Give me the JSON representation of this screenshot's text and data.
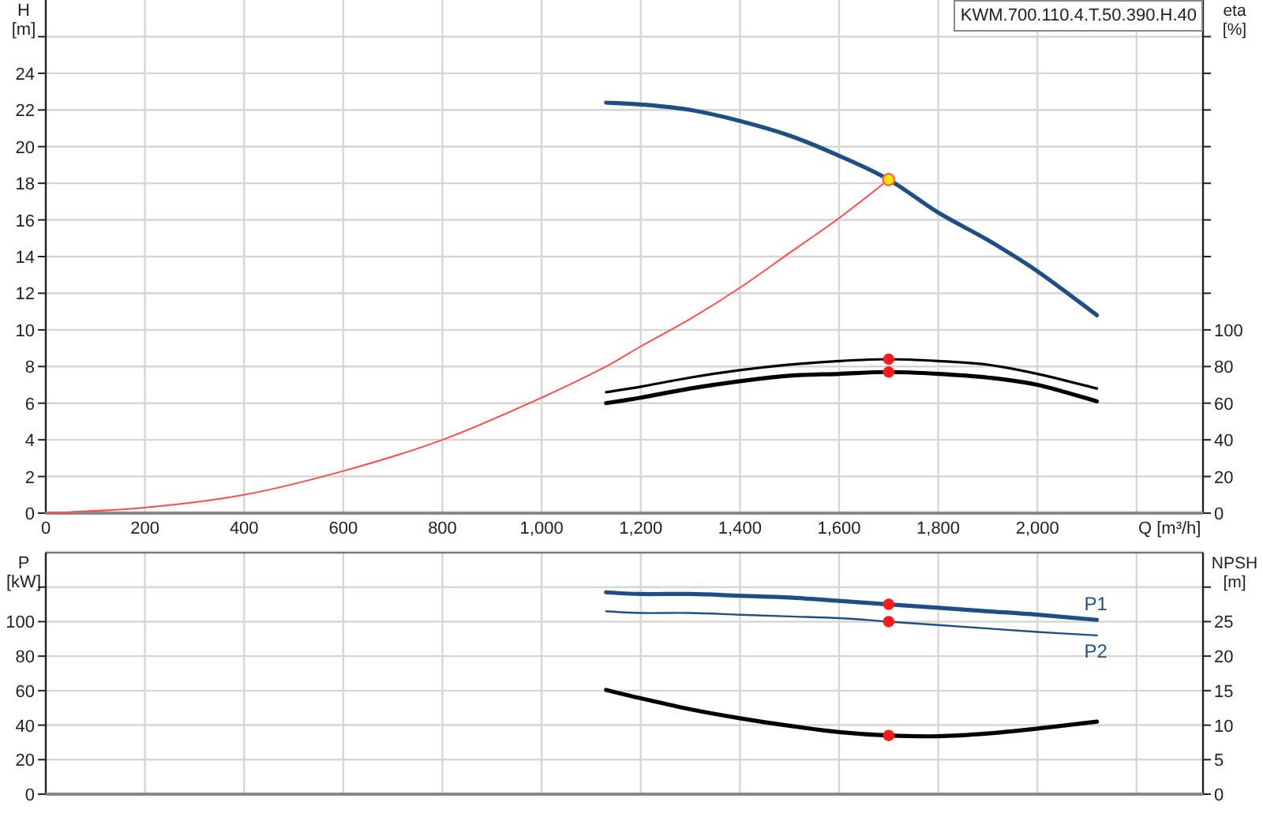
{
  "head_chart": {
    "legend": "KWM.700.110.4.T.50.390.H.40",
    "chart_data": {
      "type": "line",
      "xlabel": "Q [m³/h]",
      "ylabel": "H [m]",
      "y2label": "eta [%]",
      "grid": true,
      "x": [
        0,
        200,
        400,
        600,
        800,
        1000,
        1130,
        1200,
        1300,
        1400,
        1500,
        1600,
        1700,
        1800,
        1900,
        2000,
        2120
      ],
      "xlim": [
        0,
        2334
      ],
      "ylim": [
        0,
        28
      ],
      "y2lim": [
        0,
        280
      ],
      "xticks": [
        {
          "value": 0,
          "label": "0"
        },
        {
          "value": 200,
          "label": "200"
        },
        {
          "value": 400,
          "label": "400"
        },
        {
          "value": 600,
          "label": "600"
        },
        {
          "value": 800,
          "label": "800"
        },
        {
          "value": 1000,
          "label": "1,000"
        },
        {
          "value": 1200,
          "label": "1,200"
        },
        {
          "value": 1400,
          "label": "1,400"
        },
        {
          "value": 1600,
          "label": "1,600"
        },
        {
          "value": 1800,
          "label": "1,800"
        },
        {
          "value": 2000,
          "label": "2,000"
        }
      ],
      "yticks": [
        0,
        2,
        4,
        6,
        8,
        10,
        12,
        14,
        16,
        18,
        20,
        22,
        24
      ],
      "y2ticks": [
        0,
        20,
        40,
        60,
        80,
        100
      ],
      "series": [
        {
          "color": "#1d4f86",
          "values": [
            null,
            null,
            null,
            null,
            null,
            null,
            22.4,
            22.3,
            22.0,
            21.4,
            20.6,
            19.5,
            18.2,
            16.4,
            14.9,
            13.2,
            10.8
          ]
        },
        {
          "color": "#ff4d4d",
          "values": [
            0,
            0.3,
            1,
            2.3,
            4,
            6.3,
            8,
            9.1,
            10.6,
            12.3,
            14.2,
            16.1,
            18.2,
            null,
            null,
            null,
            null
          ]
        },
        {
          "color": "#000000",
          "axis": "y2",
          "values": [
            null,
            null,
            null,
            null,
            null,
            null,
            66,
            69,
            74,
            78,
            81,
            83,
            84,
            83,
            81,
            76,
            68
          ]
        },
        {
          "color": "#000000",
          "axis": "y2",
          "values": [
            null,
            null,
            null,
            null,
            null,
            null,
            60,
            63,
            68,
            72,
            75,
            76,
            77,
            76,
            74,
            70,
            61
          ]
        },
        {
          "color": "#ffe600",
          "marker": true,
          "values": [
            null,
            null,
            null,
            null,
            null,
            null,
            null,
            null,
            null,
            null,
            null,
            null,
            18.2,
            null,
            null,
            null,
            null
          ]
        },
        {
          "color": "#ff1a1a",
          "axis": "y2",
          "marker": true,
          "values": [
            null,
            null,
            null,
            null,
            null,
            null,
            null,
            null,
            null,
            null,
            null,
            null,
            84,
            null,
            null,
            null,
            null
          ]
        },
        {
          "color": "#ff1a1a",
          "axis": "y2",
          "marker": true,
          "values": [
            null,
            null,
            null,
            null,
            null,
            null,
            null,
            null,
            null,
            null,
            null,
            null,
            77,
            null,
            null,
            null,
            null
          ]
        }
      ]
    }
  },
  "power_chart": {
    "chart_data": {
      "type": "line",
      "ylabel": "P [kW]",
      "y2label": "NPSH [m]",
      "grid": true,
      "x": [
        1130,
        1200,
        1300,
        1400,
        1500,
        1600,
        1700,
        1800,
        1900,
        2000,
        2120
      ],
      "xlim": [
        0,
        2334
      ],
      "ylim": [
        0,
        140
      ],
      "y2lim": [
        0,
        35
      ],
      "yticks": [
        0,
        20,
        40,
        60,
        80,
        100
      ],
      "y2ticks": [
        0,
        5,
        10,
        15,
        20,
        25
      ],
      "series": [
        {
          "name": "P1",
          "color": "#1d4f86",
          "values": [
            117,
            116,
            116,
            115,
            114,
            112,
            110,
            108,
            106,
            104,
            101
          ]
        },
        {
          "name": "P2",
          "color": "#1d4f86",
          "values": [
            106,
            105,
            105,
            104,
            103,
            102,
            100,
            98,
            96,
            94,
            92
          ]
        },
        {
          "color": "#000000",
          "axis": "y2",
          "values": [
            15.1,
            13.9,
            12.3,
            11.0,
            9.9,
            9.0,
            8.5,
            8.4,
            8.8,
            9.5,
            10.5
          ]
        },
        {
          "color": "#ff1a1a",
          "marker": true,
          "values": [
            null,
            null,
            null,
            null,
            null,
            null,
            110,
            null,
            null,
            null,
            null
          ]
        },
        {
          "color": "#ff1a1a",
          "marker": true,
          "values": [
            null,
            null,
            null,
            null,
            null,
            null,
            100,
            null,
            null,
            null,
            null
          ]
        },
        {
          "color": "#ff1a1a",
          "axis": "y2",
          "marker": true,
          "values": [
            null,
            null,
            null,
            null,
            null,
            null,
            8.5,
            null,
            null,
            null,
            null
          ]
        }
      ]
    }
  }
}
